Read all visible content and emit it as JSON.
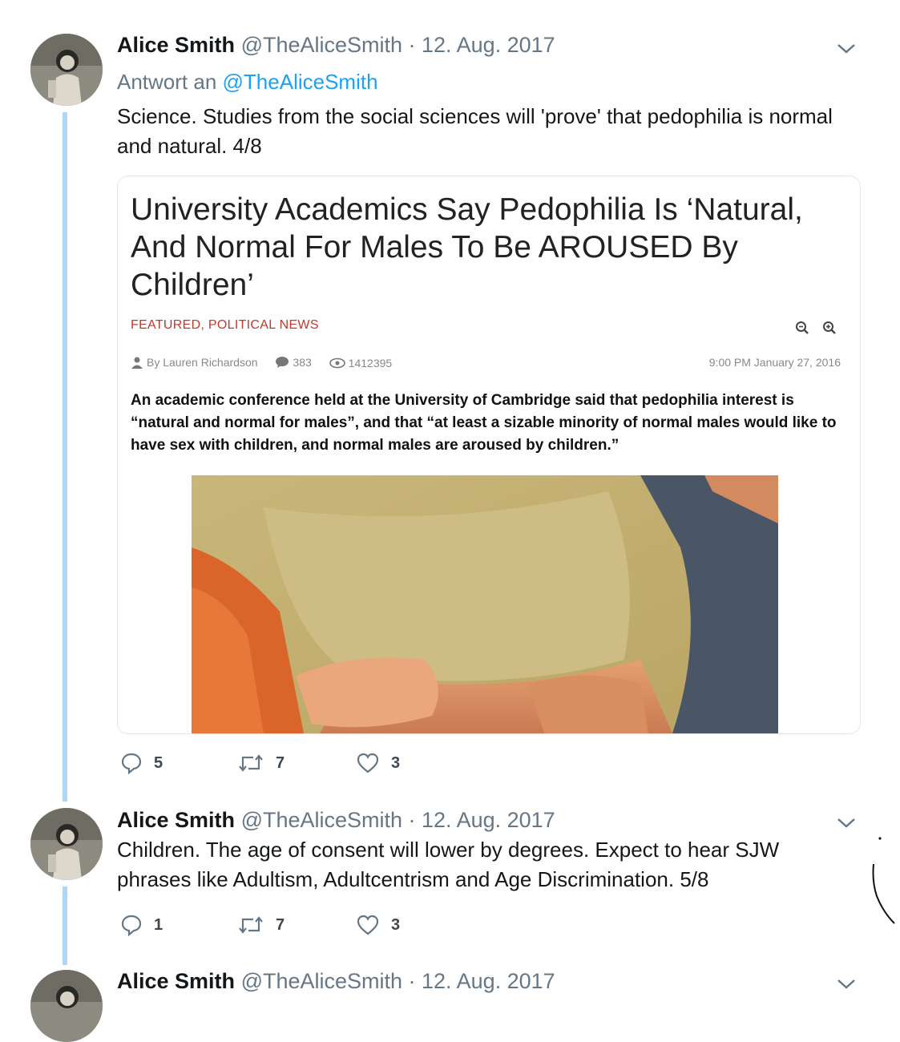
{
  "tweets": [
    {
      "name": "Alice Smith",
      "meta": "@TheAliceSmith · 12. Aug. 2017",
      "reply_to_label": "Antwort an",
      "reply_to_handle": "@TheAliceSmith",
      "text": "Science. Studies from the social sciences will 'prove' that pedophilia is normal and natural. 4/8",
      "replies": "5",
      "retweets": "7",
      "likes": "3"
    },
    {
      "name": "Alice Smith",
      "meta": "@TheAliceSmith · 12. Aug. 2017",
      "text": "Children. The age of consent will lower by degrees. Expect to hear SJW phrases like Adultism, Adultcentrism and Age Discrimination. 5/8",
      "replies": "1",
      "retweets": "7",
      "likes": "3"
    },
    {
      "name": "Alice Smith",
      "meta": "@TheAliceSmith · 12. Aug. 2017"
    }
  ],
  "article": {
    "title": "University Academics Say Pedophilia Is ‘Natural, And Normal For Males To Be AROUSED By Children’",
    "categories": "FEATURED, POLITICAL NEWS",
    "author": "By Lauren Richardson",
    "comments": "383",
    "views": "1412395",
    "date": "9:00 PM January 27, 2016",
    "lead": "An academic conference held at the University of Cambridge said that pedophilia interest is “natural and normal for males”, and that “at least a sizable minority of normal males would like to have sex with children, and normal males are aroused by children.”"
  },
  "colors": {
    "thread_line": "#b0d6f5",
    "mention": "#1da1f2",
    "meta": "#657786",
    "category": "#c0392b"
  },
  "icons": [
    "reply-icon",
    "retweet-icon",
    "like-icon",
    "chevron-down-icon",
    "zoom-out-icon",
    "zoom-in-icon",
    "user-icon",
    "comment-icon",
    "eye-icon"
  ]
}
